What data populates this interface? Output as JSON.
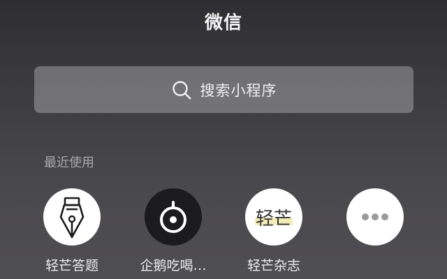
{
  "header": {
    "title": "微信"
  },
  "search": {
    "placeholder": "搜索小程序",
    "icon": "search-icon"
  },
  "recent": {
    "section_label": "最近使用",
    "apps": [
      {
        "name": "轻芒答题",
        "icon": "fountain-pen-icon"
      },
      {
        "name": "企鹅吃喝…",
        "icon": "compass-pin-icon"
      },
      {
        "name": "轻芒杂志",
        "icon": "qingmang-logo-icon",
        "logo_text": "轻芒"
      },
      {
        "name": "",
        "icon": "more-icon"
      }
    ]
  },
  "colors": {
    "background_top": "#2e2d31",
    "background_bottom": "#4f4e52",
    "search_bar": "rgba(255,255,255,0.28)",
    "logo_highlight": "#f3ecb6",
    "dark_icon_bg": "#1b1b1d"
  }
}
